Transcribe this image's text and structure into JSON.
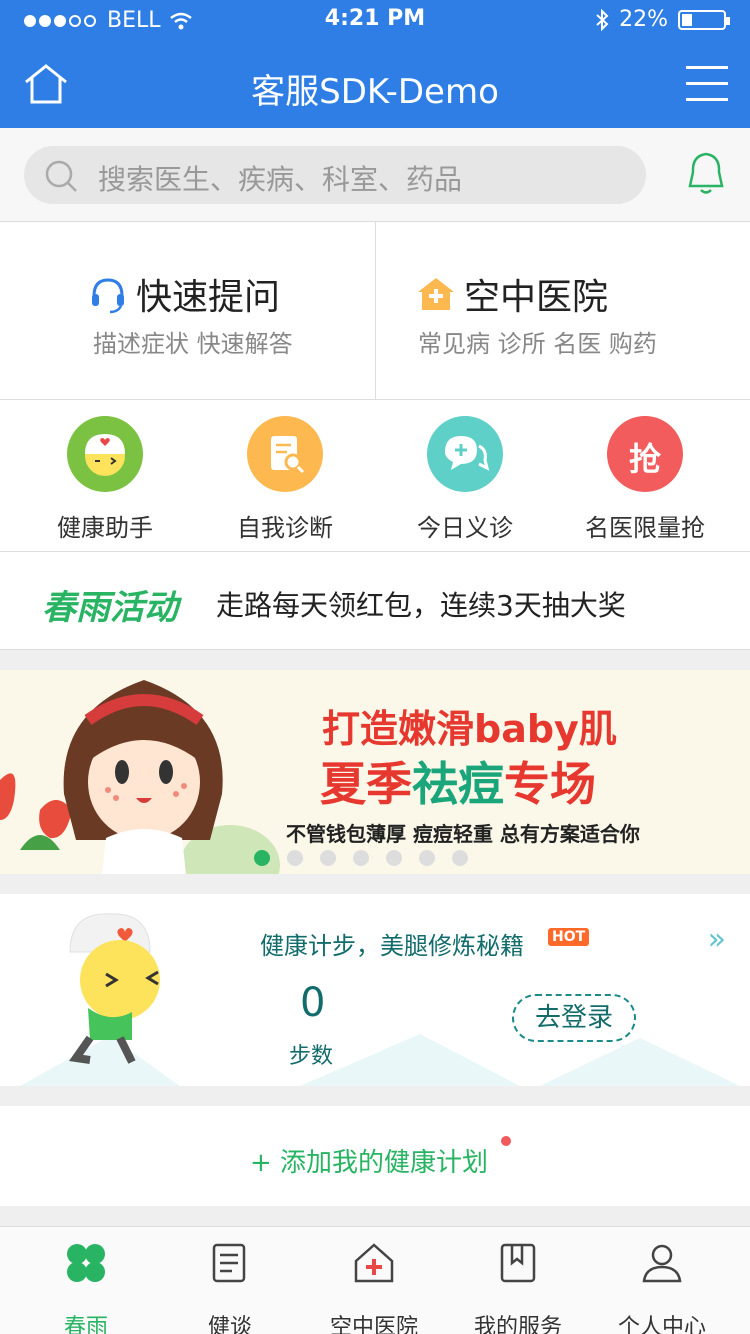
{
  "status_bar": {
    "carrier": "BELL",
    "time": "4:21 PM",
    "battery": "22%"
  },
  "nav": {
    "title": "客服SDK-Demo"
  },
  "search": {
    "placeholder": "搜索医生、疾病、科室、药品"
  },
  "quick_tiles": [
    {
      "title": "快速提问",
      "subtitle": "描述症状 快速解答"
    },
    {
      "title": "空中医院",
      "subtitle": "常见病 诊所 名医 购药"
    }
  ],
  "shortcuts": [
    {
      "label": "健康助手",
      "color": "#7cc242"
    },
    {
      "label": "自我诊断",
      "color": "#fdb94f"
    },
    {
      "label": "今日义诊",
      "color": "#5fd0c8"
    },
    {
      "label": "名医限量抢",
      "color": "#f25c5c",
      "glyph": "抢"
    }
  ],
  "activity": {
    "brand": "春雨活动",
    "text": "走路每天领红包，连续3天抽大奖"
  },
  "banner": {
    "line1": "打造嫩滑baby肌",
    "line2a": "夏季",
    "line2b": "祛痘",
    "line2c": "专场",
    "line3": "不管钱包薄厚 痘痘轻重 总有方案适合你"
  },
  "steps": {
    "title": "健康计步，美腿修炼秘籍",
    "hot": "HOT",
    "more": "»",
    "count": "0",
    "unit": "步数",
    "login": "去登录"
  },
  "add_plan": {
    "label": "+ 添加我的健康计划"
  },
  "tabs": [
    {
      "label": "春雨",
      "active": true
    },
    {
      "label": "健谈",
      "active": false
    },
    {
      "label": "空中医院",
      "active": false
    },
    {
      "label": "我的服务",
      "active": false
    },
    {
      "label": "个人中心",
      "active": false
    }
  ],
  "colors": {
    "primary": "#2f7ee6",
    "green": "#28b463"
  }
}
